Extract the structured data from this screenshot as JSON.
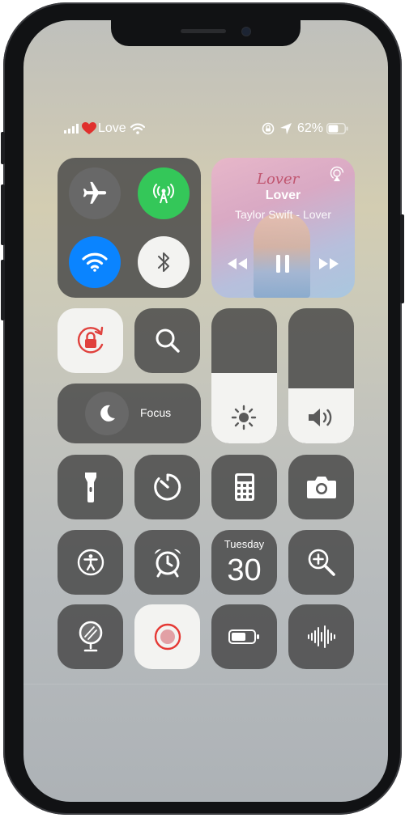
{
  "status_bar": {
    "carrier": "Love",
    "battery_percent": "62%",
    "battery_level": 0.62
  },
  "now_playing": {
    "album_script": "Lover",
    "title": "Lover",
    "artist_album": "Taylor Swift - Lover"
  },
  "focus": {
    "label": "Focus"
  },
  "calendar": {
    "day_name": "Tuesday",
    "day_number": "30"
  },
  "sliders": {
    "brightness_level": 0.52,
    "volume_level": 0.41
  },
  "colors": {
    "cellular_green": "#34c759",
    "wifi_blue": "#0a84ff",
    "rotation_lock_red": "#e0413d",
    "record_red": "#e53935"
  },
  "icons": {
    "connectivity": [
      "airplane-icon",
      "cellular-antenna-icon",
      "wifi-icon",
      "bluetooth-icon"
    ],
    "row_controls": [
      "flashlight-icon",
      "timer-icon",
      "calculator-icon",
      "camera-icon"
    ],
    "row_accessibility": [
      "accessibility-icon",
      "alarm-clock-icon",
      "calendar-widget",
      "magnifier-icon"
    ],
    "row_bottom": [
      "mirror-icon",
      "screen-record-icon",
      "low-power-battery-icon",
      "sound-recognition-icon"
    ]
  }
}
